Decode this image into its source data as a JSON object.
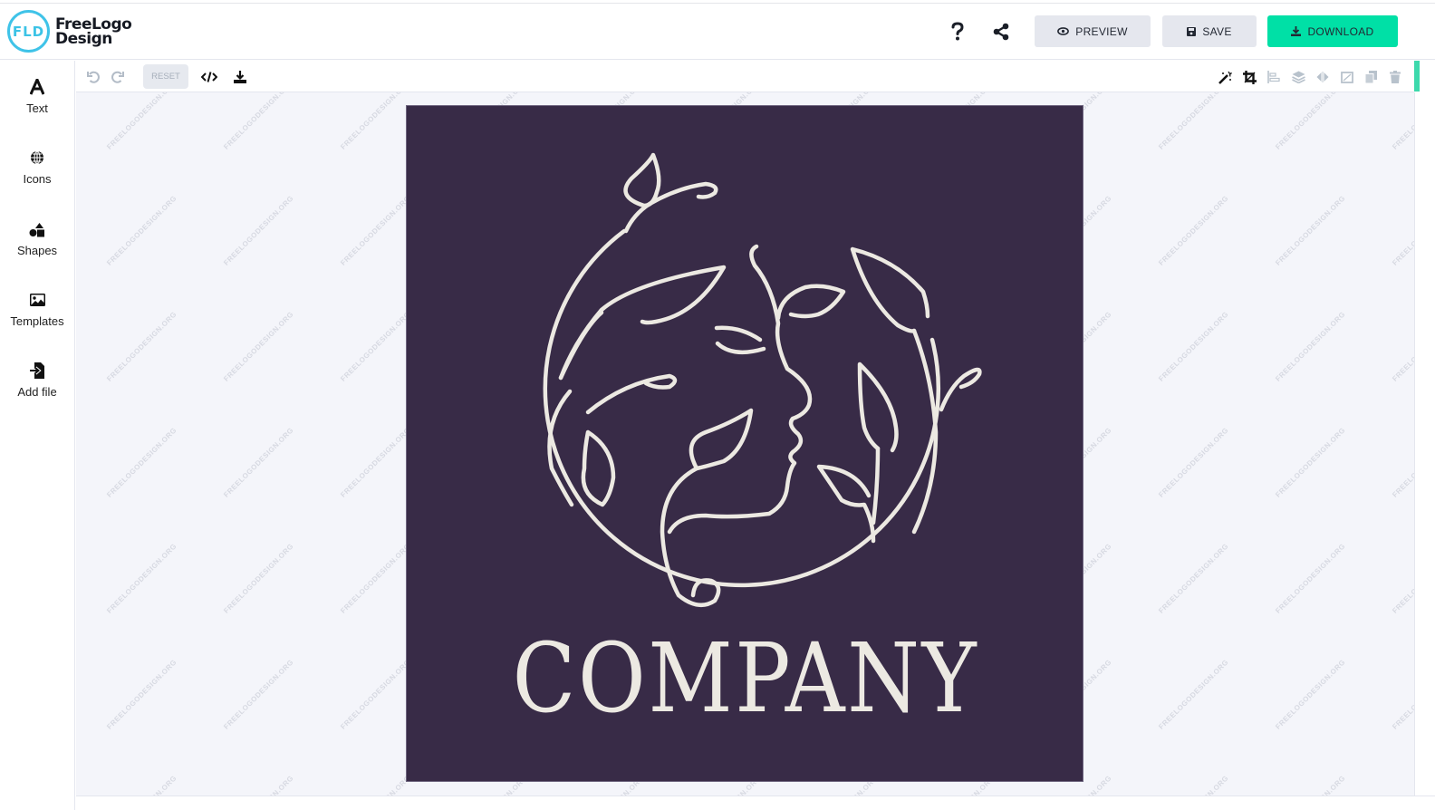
{
  "brand": {
    "mark": "FLD",
    "line1": "FreeLogo",
    "line2": "Design"
  },
  "header": {
    "help_icon": "question-icon",
    "share_icon": "share-icon",
    "preview_label": "PREVIEW",
    "save_label": "SAVE",
    "download_label": "DOWNLOAD",
    "accent_color": "#00e0a6"
  },
  "sidebar": {
    "items": [
      {
        "label": "Text",
        "icon": "text-icon"
      },
      {
        "label": "Icons",
        "icon": "globe-icon"
      },
      {
        "label": "Shapes",
        "icon": "shapes-icon"
      },
      {
        "label": "Templates",
        "icon": "image-icon"
      },
      {
        "label": "Add file",
        "icon": "file-import-icon"
      }
    ]
  },
  "toolbar": {
    "reset_label": "RESET",
    "left_icons": [
      "undo-icon",
      "redo-icon",
      "code-icon",
      "download-icon"
    ],
    "right_icons": [
      "magic-wand-icon",
      "crop-icon",
      "align-icon",
      "layers-icon",
      "flip-icon",
      "resize-icon",
      "copy-icon",
      "trash-icon"
    ]
  },
  "canvas": {
    "watermark": "FREELOGODESIGN.ORG",
    "background_color": "#382b47",
    "foreground_color": "#ece9e2",
    "company_text": "COMPANY"
  }
}
